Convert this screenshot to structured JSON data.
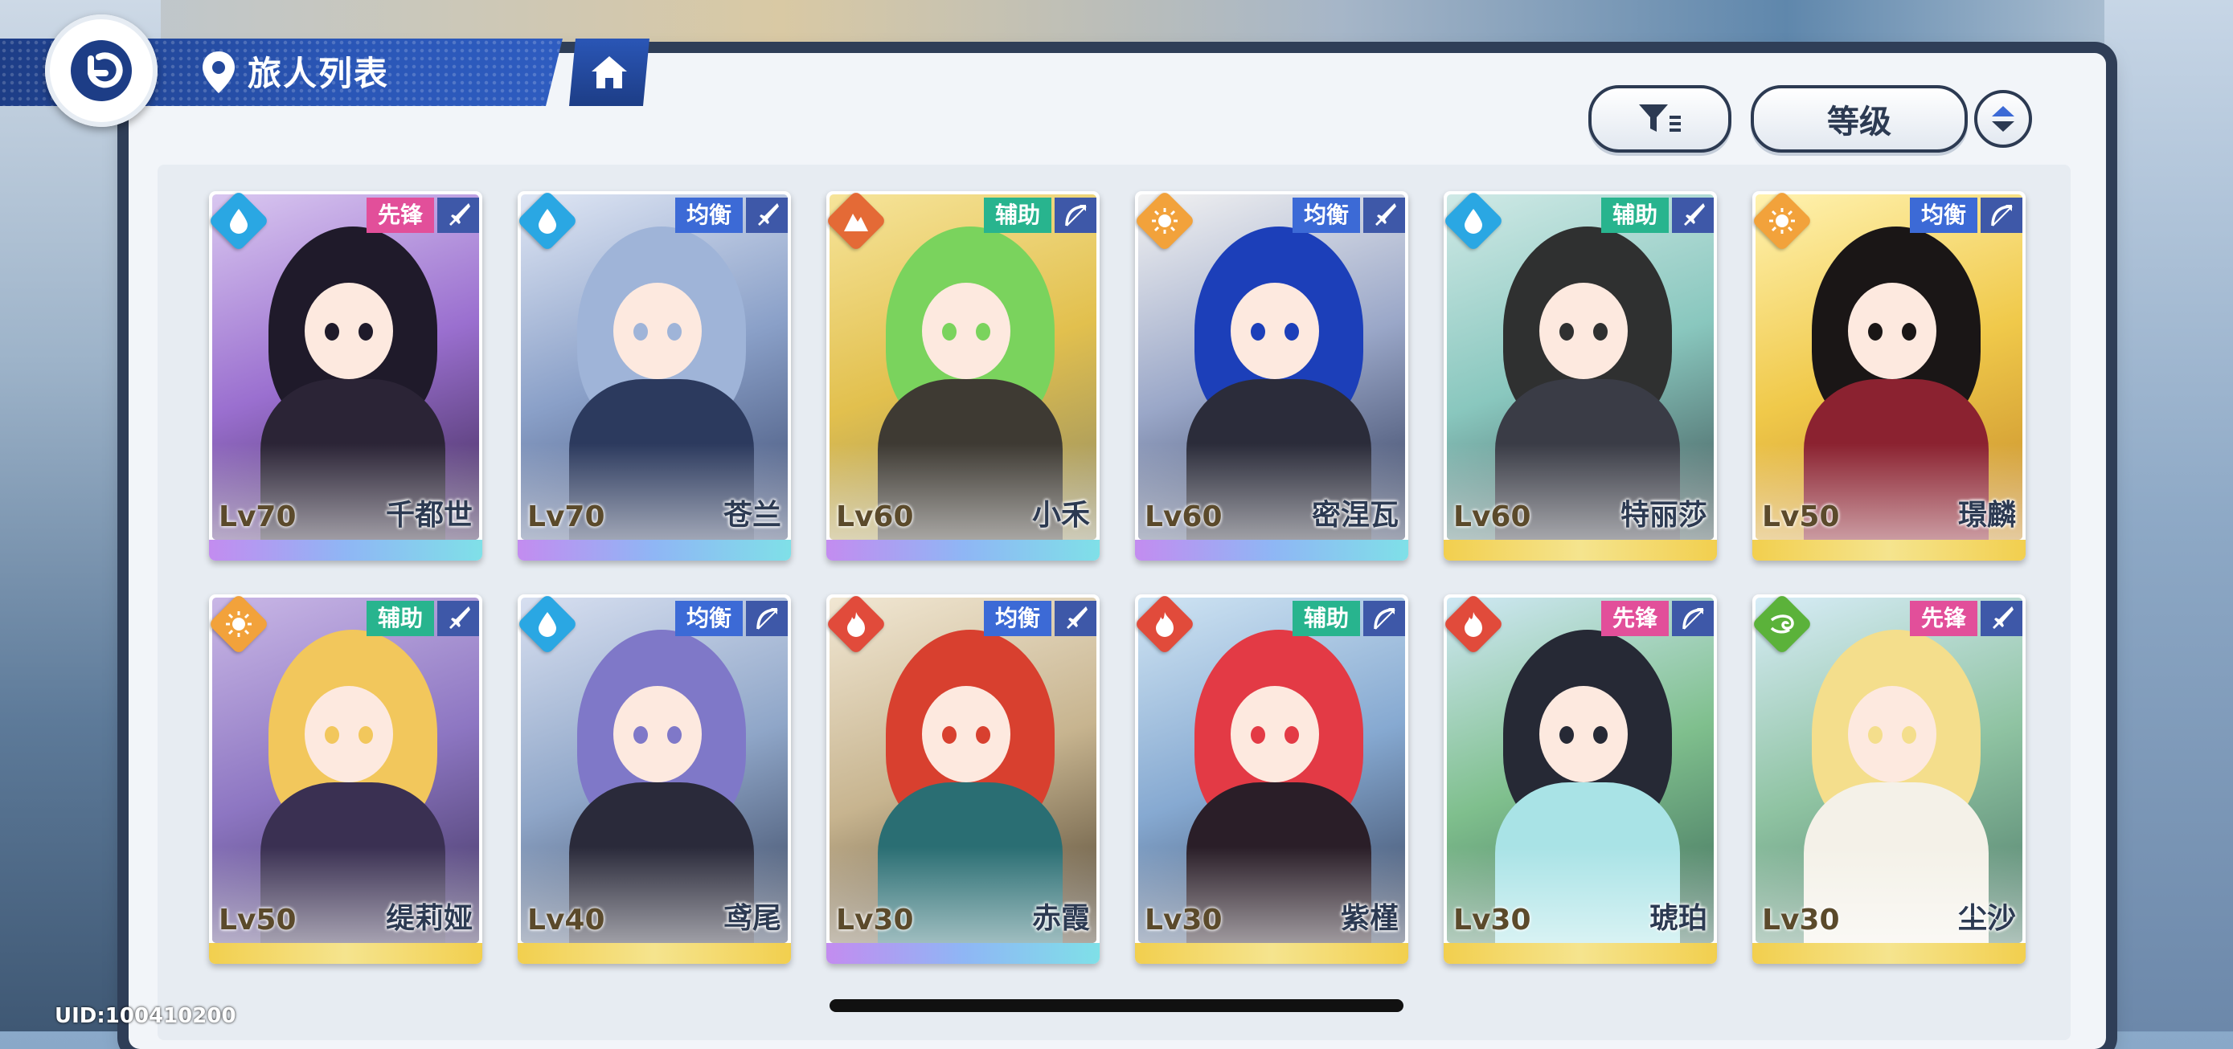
{
  "header": {
    "title": "旅人列表"
  },
  "sort": {
    "label": "等级"
  },
  "footer": {
    "uid": "UID:100410200"
  },
  "colors": {
    "water": "#2aa7e3",
    "sun": "#f2a23b",
    "earth": "#e46a36",
    "fire": "#e14b3b",
    "wind": "#5bb23a",
    "vanguard": "#e24f9a",
    "balance": "#3c6ad6",
    "support": "#28b48e"
  },
  "characters": [
    {
      "name": "千都世",
      "level": "Lv70",
      "role": "先锋",
      "element": "water-icon",
      "weapon": "sword-icon",
      "frame": "rainbow"
    },
    {
      "name": "苍兰",
      "level": "Lv70",
      "role": "均衡",
      "element": "water-icon",
      "weapon": "sword-icon",
      "frame": "rainbow"
    },
    {
      "name": "小禾",
      "level": "Lv60",
      "role": "辅助",
      "element": "earth-icon",
      "weapon": "bow-icon",
      "frame": "rainbow"
    },
    {
      "name": "密涅瓦",
      "level": "Lv60",
      "role": "均衡",
      "element": "sun-icon",
      "weapon": "sword-icon",
      "frame": "rainbow"
    },
    {
      "name": "特丽莎",
      "level": "Lv60",
      "role": "辅助",
      "element": "water-icon",
      "weapon": "sword-icon",
      "frame": "gold"
    },
    {
      "name": "璟麟",
      "level": "Lv50",
      "role": "均衡",
      "element": "sun-icon",
      "weapon": "bow-icon",
      "frame": "gold"
    },
    {
      "name": "缇莉娅",
      "level": "Lv50",
      "role": "辅助",
      "element": "sun-icon",
      "weapon": "sword-icon",
      "frame": "gold"
    },
    {
      "name": "鸢尾",
      "level": "Lv40",
      "role": "均衡",
      "element": "water-icon",
      "weapon": "bow-icon",
      "frame": "gold"
    },
    {
      "name": "赤霞",
      "level": "Lv30",
      "role": "均衡",
      "element": "fire-icon",
      "weapon": "sword-icon",
      "frame": "rainbow"
    },
    {
      "name": "紫槿",
      "level": "Lv30",
      "role": "辅助",
      "element": "fire-icon",
      "weapon": "bow-icon",
      "frame": "gold"
    },
    {
      "name": "琥珀",
      "level": "Lv30",
      "role": "先锋",
      "element": "fire-icon",
      "weapon": "bow-icon",
      "frame": "gold"
    },
    {
      "name": "尘沙",
      "level": "Lv30",
      "role": "先锋",
      "element": "wind-icon",
      "weapon": "sword-icon",
      "frame": "gold"
    }
  ]
}
